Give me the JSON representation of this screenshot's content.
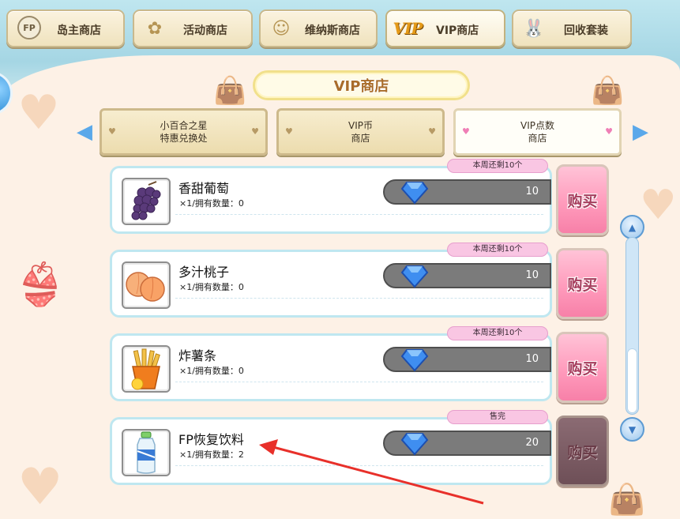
{
  "top_tabs": [
    {
      "label": "岛主商店",
      "icon": "fp-badge-icon"
    },
    {
      "label": "活动商店",
      "icon": "flower-icon"
    },
    {
      "label": "维纳斯商店",
      "icon": "girls-icon"
    },
    {
      "label": "VIP商店",
      "icon": "vip-badge-icon",
      "badge_text": "VIP",
      "active": true
    },
    {
      "label": "回收套装",
      "icon": "bunny-bag-icon"
    }
  ],
  "fp_badge_text": "FP",
  "title": "VIP商店",
  "sub_tabs": [
    {
      "line1": "小百合之星",
      "line2": "特惠兑换处"
    },
    {
      "line1": "VIP币",
      "line2": "商店"
    },
    {
      "line1": "VIP点数",
      "line2": "商店",
      "active": true
    }
  ],
  "nav": {
    "left_arrow": "◀",
    "right_arrow": "▶"
  },
  "items": [
    {
      "name": "香甜葡萄",
      "subtitle": "×1/拥有数量：0",
      "price": "10",
      "tag": "本周还剩10个",
      "buy_label": "购买",
      "icon": "grapes-icon"
    },
    {
      "name": "多汁桃子",
      "subtitle": "×1/拥有数量：0",
      "price": "10",
      "tag": "本周还剩10个",
      "buy_label": "购买",
      "icon": "peach-icon"
    },
    {
      "name": "炸薯条",
      "subtitle": "×1/拥有数量：0",
      "price": "10",
      "tag": "本周还剩10个",
      "buy_label": "购买",
      "icon": "fries-icon"
    },
    {
      "name": "FP恢复饮料",
      "subtitle": "×1/拥有数量：2",
      "price": "20",
      "tag": "售完",
      "buy_label": "购买",
      "icon": "water-bottle-icon",
      "sold_out": true
    }
  ],
  "scroll_up": "▲",
  "scroll_down": "▼",
  "annotation_color": "#e8302a",
  "gem_color": "#2f7fe0",
  "accent_pink": "#ff9bbc"
}
